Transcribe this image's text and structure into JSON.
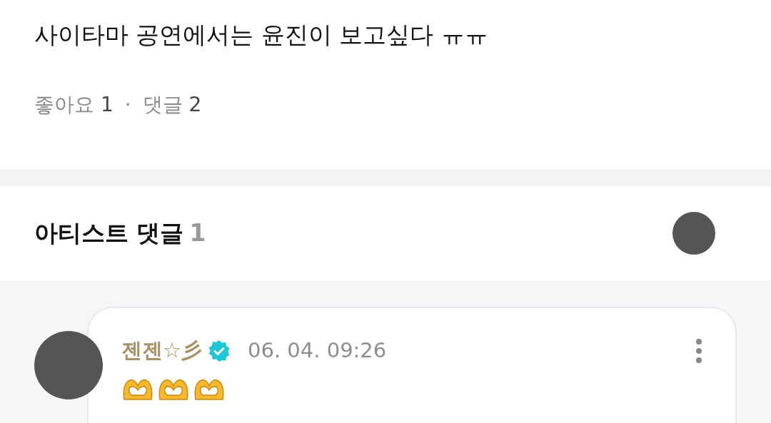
{
  "post": {
    "text": "사이타마 공연에서는 윤진이 보고싶다 ㅠㅠ",
    "likes_label": "좋아요",
    "likes_count": "1",
    "separator": "·",
    "comments_label": "댓글",
    "comments_count": "2"
  },
  "artist_comments": {
    "title": "아티스트 댓글",
    "count": "1",
    "comments": [
      {
        "author": "젠젠☆彡",
        "verified": true,
        "time": "06. 04. 09:26",
        "body": [
          {
            "kind": "heart_hands"
          },
          {
            "kind": "heart_hands"
          },
          {
            "kind": "heart_hands"
          }
        ]
      }
    ]
  }
}
